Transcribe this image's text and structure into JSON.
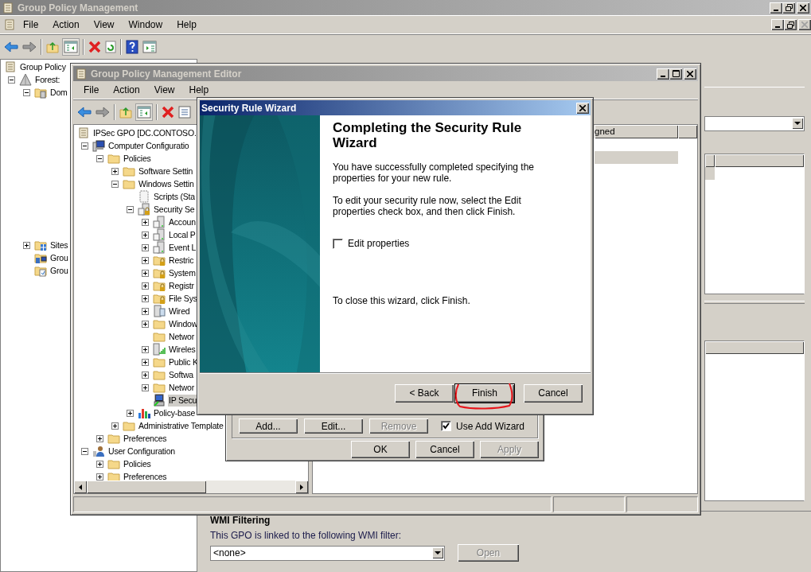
{
  "main_window": {
    "title": "Group Policy Management",
    "menu": [
      "File",
      "Action",
      "View",
      "Window",
      "Help"
    ],
    "tree": [
      {
        "label": "Group Policy",
        "kind": "scroll",
        "selected": false,
        "children": [
          {
            "label": "Forest:",
            "kind": "pyramid",
            "expanded": true,
            "selected": false,
            "children": [
              {
                "label": "Dom",
                "kind": "domain",
                "expanded": true,
                "selected": false
              },
              {
                "label": "Sites",
                "kind": "sites",
                "expanded": false,
                "selected": false
              },
              {
                "label": "Grou",
                "kind": "gpo-folder",
                "selected": false
              },
              {
                "label": "Grou",
                "kind": "doc-folder",
                "selected": false
              }
            ]
          }
        ]
      }
    ],
    "wmi": {
      "heading": "WMI Filtering",
      "text": "This GPO is linked to the following WMI filter:",
      "filter": "<none>",
      "open_button": {
        "label": "Open",
        "disabled": true
      }
    }
  },
  "editor": {
    "title": "Group Policy Management Editor",
    "menu": [
      "File",
      "Action",
      "View",
      "Help"
    ],
    "tree": [
      {
        "label": "IPSec GPO [DC.CONTOSO.",
        "kind": "scroll",
        "selected": false,
        "children": [
          {
            "label": "Computer Configuratio",
            "kind": "computer",
            "expanded": true,
            "selected": false,
            "children": [
              {
                "label": "Policies",
                "kind": "folder",
                "expanded": true,
                "selected": false,
                "children": [
                  {
                    "label": "Software Settin",
                    "kind": "folder",
                    "expanded": false,
                    "selected": false
                  },
                  {
                    "label": "Windows Settin",
                    "kind": "folder",
                    "expanded": true,
                    "selected": false,
                    "children": [
                      {
                        "label": "Scripts (Sta",
                        "kind": "script",
                        "selected": false
                      },
                      {
                        "label": "Security Se",
                        "kind": "security",
                        "expanded": true,
                        "selected": false,
                        "children": [
                          {
                            "label": "Accoun",
                            "kind": "server",
                            "expanded": false,
                            "selected": false
                          },
                          {
                            "label": "Local P",
                            "kind": "server",
                            "expanded": false,
                            "selected": false
                          },
                          {
                            "label": "Event L",
                            "kind": "server",
                            "expanded": false,
                            "selected": false
                          },
                          {
                            "label": "Restric",
                            "kind": "locked-folder",
                            "expanded": false,
                            "selected": false
                          },
                          {
                            "label": "System",
                            "kind": "locked-folder",
                            "expanded": false,
                            "selected": false
                          },
                          {
                            "label": "Registr",
                            "kind": "locked-folder",
                            "expanded": false,
                            "selected": false
                          },
                          {
                            "label": "File Sys",
                            "kind": "locked-folder",
                            "expanded": false,
                            "selected": false
                          },
                          {
                            "label": "Wired",
                            "kind": "wired",
                            "expanded": false,
                            "selected": false
                          },
                          {
                            "label": "Window",
                            "kind": "folder",
                            "expanded": false,
                            "selected": false
                          },
                          {
                            "label": "Networ",
                            "kind": "folder",
                            "selected": false
                          },
                          {
                            "label": "Wireles",
                            "kind": "wireless",
                            "expanded": false,
                            "selected": false
                          },
                          {
                            "label": "Public K",
                            "kind": "folder",
                            "expanded": false,
                            "selected": false
                          },
                          {
                            "label": "Softwa",
                            "kind": "folder",
                            "expanded": false,
                            "selected": false
                          },
                          {
                            "label": "Networ",
                            "kind": "folder",
                            "expanded": false,
                            "selected": false
                          },
                          {
                            "label": "IP Secu",
                            "kind": "ipsec",
                            "selected": true
                          }
                        ]
                      },
                      {
                        "label": "Policy-base",
                        "kind": "chart",
                        "expanded": false,
                        "selected": false
                      }
                    ]
                  },
                  {
                    "label": "Administrative Template",
                    "kind": "folder",
                    "expanded": false,
                    "selected": false
                  }
                ]
              },
              {
                "label": "Preferences",
                "kind": "folder",
                "expanded": false,
                "selected": false
              }
            ]
          },
          {
            "label": "User Configuration",
            "kind": "user",
            "expanded": true,
            "selected": false,
            "children": [
              {
                "label": "Policies",
                "kind": "folder",
                "expanded": false,
                "selected": false
              },
              {
                "label": "Preferences",
                "kind": "folder",
                "expanded": false,
                "selected": false
              }
            ]
          }
        ]
      }
    ],
    "column": "gned"
  },
  "properties_dialog": {
    "buttons": [
      {
        "label": "Add...",
        "disabled": false
      },
      {
        "label": "Edit...",
        "disabled": false
      },
      {
        "label": "Remove",
        "disabled": true
      }
    ],
    "use_add_wizard": {
      "label": "Use Add Wizard",
      "checked": true
    },
    "footer_buttons": [
      {
        "label": "OK",
        "disabled": false
      },
      {
        "label": "Cancel",
        "disabled": false
      },
      {
        "label": "Apply",
        "disabled": true
      }
    ]
  },
  "wizard": {
    "title": "Security Rule Wizard",
    "heading": "Completing the Security Rule Wizard",
    "paragraphs": [
      "You have successfully completed specifying the properties for your new rule.",
      "To edit your security rule now, select the Edit properties check box, and then click Finish."
    ],
    "edit_properties": {
      "label": "Edit properties",
      "checked": false
    },
    "closing": "To close this wizard, click Finish.",
    "buttons": [
      {
        "label": "< Back",
        "default": false
      },
      {
        "label": "Finish",
        "default": true
      },
      {
        "label": "Cancel",
        "default": false
      }
    ]
  }
}
